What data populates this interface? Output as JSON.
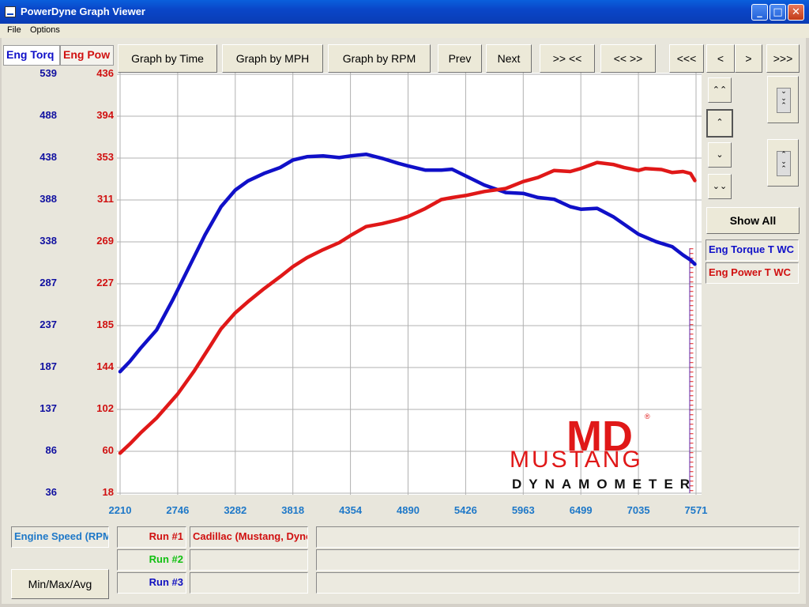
{
  "window": {
    "title": "PowerDyne Graph Viewer",
    "minimize": "_",
    "maximize": "□",
    "close": "✕"
  },
  "menu": [
    "File",
    "Options"
  ],
  "tabs": [
    "Eng Torq",
    "Eng Pow"
  ],
  "toolbar": {
    "graph_time": "Graph by Time",
    "graph_mph": "Graph by MPH",
    "graph_rpm": "Graph by RPM",
    "prev": "Prev",
    "next": "Next",
    "zoom_in": ">> <<",
    "zoom_out": "<< >>",
    "first": "<<<",
    "step_back": "<",
    "step_fwd": ">",
    "last": ">>>"
  },
  "side": {
    "up_fast": "⌃⌃",
    "up": "⌃",
    "down": "⌄",
    "down_fast": "⌄⌄",
    "show_all": "Show All",
    "legend_torque": "Eng Torque T WC",
    "legend_power": "Eng Power T WC"
  },
  "bottom": {
    "x_channel": "Engine Speed (RPM)",
    "min_max_avg": "Min/Max/Avg",
    "runs": [
      {
        "label": "Run #1",
        "color": "#d01010",
        "desc": "Cadillac (Mustang, Dyno)"
      },
      {
        "label": "Run #2",
        "color": "#10c010",
        "desc": ""
      },
      {
        "label": "Run #3",
        "color": "#1010c0",
        "desc": ""
      }
    ]
  },
  "logo": {
    "mark": "MD",
    "brand": "MUSTANG",
    "sub": "DYNAMOMETER",
    "reg": "®"
  },
  "colors": {
    "torque": "#1010c8",
    "power": "#e01818",
    "x_axis": "#1e78c8",
    "grid": "#b0b0b0"
  },
  "chart_data": {
    "type": "line",
    "x_ticks": [
      "2210",
      "2746",
      "3282",
      "3818",
      "4354",
      "4890",
      "5426",
      "5963",
      "6499",
      "7035",
      "7571"
    ],
    "torque_ticks": [
      "539",
      "488",
      "438",
      "388",
      "338",
      "287",
      "237",
      "187",
      "137",
      "86",
      "36"
    ],
    "power_ticks": [
      "436",
      "394",
      "353",
      "311",
      "269",
      "227",
      "185",
      "144",
      "102",
      "60",
      "18"
    ],
    "xlim": [
      2210,
      7571
    ],
    "torque_ylim": [
      36,
      539
    ],
    "power_ylim": [
      18,
      436
    ],
    "grid": true,
    "series": [
      {
        "name": "Eng Torque T WC",
        "axis": "left",
        "points": [
          [
            2210,
            182
          ],
          [
            2300,
            194
          ],
          [
            2400,
            210
          ],
          [
            2550,
            232
          ],
          [
            2700,
            268
          ],
          [
            2850,
            307
          ],
          [
            3000,
            346
          ],
          [
            3150,
            380
          ],
          [
            3282,
            400
          ],
          [
            3400,
            411
          ],
          [
            3550,
            420
          ],
          [
            3700,
            427
          ],
          [
            3818,
            436
          ],
          [
            3950,
            440
          ],
          [
            4100,
            441
          ],
          [
            4250,
            439
          ],
          [
            4354,
            441
          ],
          [
            4500,
            443
          ],
          [
            4650,
            438
          ],
          [
            4800,
            432
          ],
          [
            4890,
            429
          ],
          [
            5050,
            424
          ],
          [
            5200,
            424
          ],
          [
            5300,
            425
          ],
          [
            5426,
            417
          ],
          [
            5600,
            406
          ],
          [
            5800,
            397
          ],
          [
            5963,
            396
          ],
          [
            6100,
            391
          ],
          [
            6250,
            389
          ],
          [
            6400,
            380
          ],
          [
            6499,
            377
          ],
          [
            6650,
            378
          ],
          [
            6800,
            368
          ],
          [
            7035,
            347
          ],
          [
            7200,
            338
          ],
          [
            7350,
            332
          ],
          [
            7450,
            322
          ],
          [
            7520,
            316
          ],
          [
            7560,
            311
          ]
        ]
      },
      {
        "name": "Eng Power T WC",
        "axis": "right",
        "points": [
          [
            2210,
            58
          ],
          [
            2300,
            67
          ],
          [
            2400,
            78
          ],
          [
            2550,
            93
          ],
          [
            2746,
            117
          ],
          [
            2900,
            140
          ],
          [
            3050,
            165
          ],
          [
            3150,
            182
          ],
          [
            3282,
            198
          ],
          [
            3400,
            209
          ],
          [
            3550,
            222
          ],
          [
            3700,
            234
          ],
          [
            3818,
            244
          ],
          [
            3950,
            253
          ],
          [
            4100,
            261
          ],
          [
            4250,
            268
          ],
          [
            4354,
            275
          ],
          [
            4500,
            284
          ],
          [
            4650,
            287
          ],
          [
            4800,
            291
          ],
          [
            4890,
            294
          ],
          [
            5050,
            302
          ],
          [
            5200,
            311
          ],
          [
            5300,
            313
          ],
          [
            5426,
            315
          ],
          [
            5600,
            319
          ],
          [
            5800,
            322
          ],
          [
            5963,
            329
          ],
          [
            6100,
            333
          ],
          [
            6250,
            340
          ],
          [
            6400,
            339
          ],
          [
            6499,
            342
          ],
          [
            6650,
            348
          ],
          [
            6800,
            346
          ],
          [
            6900,
            343
          ],
          [
            7035,
            340
          ],
          [
            7100,
            342
          ],
          [
            7250,
            341
          ],
          [
            7350,
            338
          ],
          [
            7450,
            339
          ],
          [
            7520,
            337
          ],
          [
            7560,
            330
          ]
        ]
      }
    ],
    "run_tail": {
      "name": "Run #1",
      "x": 7571,
      "y_top_torque": 330,
      "y_bottom_torque": 36
    }
  }
}
